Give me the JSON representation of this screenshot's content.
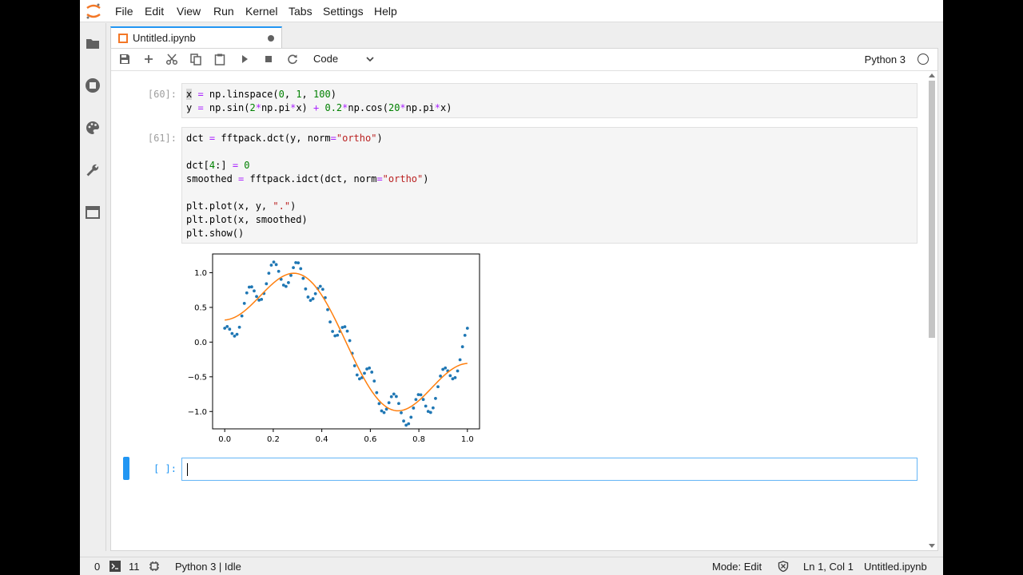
{
  "menu": [
    "File",
    "Edit",
    "View",
    "Run",
    "Kernel",
    "Tabs",
    "Settings",
    "Help"
  ],
  "tab": {
    "title": "Untitled.ipynb"
  },
  "toolbar": {
    "cell_type": "Code",
    "kernel_name": "Python 3",
    "icons": [
      "save-icon",
      "add-icon",
      "cut-icon",
      "copy-icon",
      "paste-icon",
      "run-icon",
      "stop-icon",
      "restart-icon"
    ]
  },
  "cells": [
    {
      "prompt": "[60]:",
      "lines": [
        "x = np.linspace(0, 1, 100)",
        "y = np.sin(2*np.pi*x) + 0.2*np.cos(20*np.pi*x)"
      ]
    },
    {
      "prompt": "[61]:",
      "lines": [
        "dct = fftpack.dct(y, norm=\"ortho\")",
        "",
        "dct[4:] = 0",
        "smoothed = fftpack.idct(dct, norm=\"ortho\")",
        "",
        "plt.plot(x, y, \".\")",
        "plt.plot(x, smoothed)",
        "plt.show()"
      ]
    },
    {
      "prompt": "[ ]:",
      "lines": [
        ""
      ]
    }
  ],
  "chart_data": {
    "type": "line",
    "title": "",
    "xlabel": "",
    "ylabel": "",
    "xlim": [
      -0.05,
      1.05
    ],
    "ylim": [
      -1.25,
      1.27
    ],
    "xticks": [
      "0.0",
      "0.2",
      "0.4",
      "0.6",
      "0.8",
      "1.0"
    ],
    "yticks": [
      "1.0",
      "0.5",
      "0.0",
      "−0.5",
      "−1.0"
    ],
    "grid": false,
    "series": [
      {
        "style": "markers",
        "color": "#1f77b4",
        "expr": "sin(2*pi*x) + 0.2*cos(20*pi*x), x = linspace(0, 1, 100)"
      },
      {
        "style": "line",
        "color": "#ff7f0e",
        "expr": "DCT-smoothed (first 4 coefficients)"
      }
    ]
  },
  "status": {
    "left_count_a": "0",
    "left_count_b": "11",
    "kernel_state": "Python 3 | Idle",
    "mode": "Mode: Edit",
    "position": "Ln 1, Col 1",
    "file": "Untitled.ipynb"
  }
}
